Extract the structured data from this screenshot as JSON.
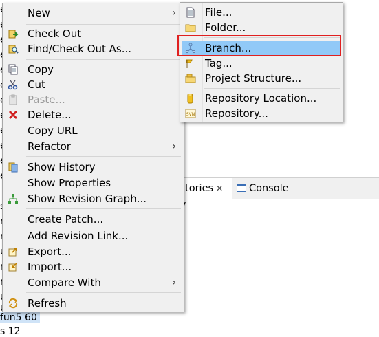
{
  "background": {
    "lines": [
      "e",
      "e",
      "e",
      "e",
      "e",
      "e",
      "e",
      "e",
      "e",
      "e",
      "e",
      "e",
      "s",
      "r",
      "r",
      "u",
      "ru",
      "ru",
      "u",
      "u",
      "fun5 60",
      "s 12"
    ],
    "tabs": {
      "repositories": "itories",
      "console": "Console",
      "extra": "y"
    }
  },
  "context_menu": {
    "items": [
      {
        "label": "New",
        "icon": "",
        "submenu": true
      },
      {
        "label": "Check Out",
        "icon": "checkout-icon"
      },
      {
        "label": "Find/Check Out As...",
        "icon": "find-checkout-icon"
      },
      {
        "label": "Copy",
        "icon": "copy-icon"
      },
      {
        "label": "Cut",
        "icon": "cut-icon"
      },
      {
        "label": "Paste...",
        "icon": "paste-icon",
        "disabled": true
      },
      {
        "label": "Delete...",
        "icon": "delete-icon"
      },
      {
        "label": "Copy URL",
        "icon": ""
      },
      {
        "label": "Refactor",
        "icon": "",
        "submenu": true
      },
      {
        "label": "Show History",
        "icon": "history-icon"
      },
      {
        "label": "Show Properties",
        "icon": ""
      },
      {
        "label": "Show Revision Graph...",
        "icon": "revision-graph-icon"
      },
      {
        "label": "Create Patch...",
        "icon": ""
      },
      {
        "label": "Add Revision Link...",
        "icon": ""
      },
      {
        "label": "Export...",
        "icon": "export-icon"
      },
      {
        "label": "Import...",
        "icon": "import-icon"
      },
      {
        "label": "Compare With",
        "icon": "",
        "submenu": true
      },
      {
        "label": "Refresh",
        "icon": "refresh-icon"
      }
    ],
    "arrow": "›"
  },
  "new_submenu": {
    "items": [
      {
        "label": "File...",
        "icon": "file-icon"
      },
      {
        "label": "Folder...",
        "icon": "folder-icon"
      },
      {
        "label": "Branch...",
        "icon": "branch-icon",
        "highlighted": true
      },
      {
        "label": "Tag...",
        "icon": "tag-icon"
      },
      {
        "label": "Project Structure...",
        "icon": "project-structure-icon"
      },
      {
        "label": "Repository Location...",
        "icon": "repository-location-icon"
      },
      {
        "label": "Repository...",
        "icon": "repository-icon"
      }
    ]
  },
  "colors": {
    "highlight": "#91c9f7",
    "annotation_box": "#e02020",
    "menu_bg": "#f0f0f0"
  }
}
